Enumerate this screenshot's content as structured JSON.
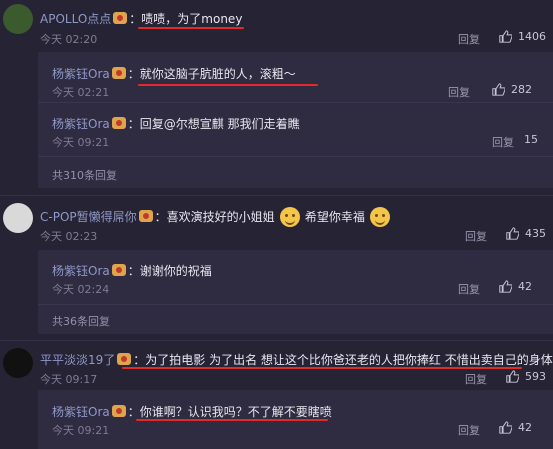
{
  "comments": [
    {
      "user": "APOLLO点点",
      "text": "啧啧，为了money",
      "time": "今天 02:20",
      "reply_label": "回复",
      "likes": "1406",
      "sub": [
        {
          "user": "杨紫钰Ora",
          "text": "就你这脑子肮脏的人，滚粗～",
          "time": "今天 02:21",
          "reply_label": "回复",
          "likes": "282"
        },
        {
          "user": "杨紫钰Ora",
          "text": "回复@尔想宣麒 那我们走着瞧",
          "time": "今天 09:21",
          "reply_label": "回复",
          "likes": "15"
        }
      ],
      "more": "共310条回复"
    },
    {
      "user": "C-POP暂懒得屌你",
      "text_a": "喜欢演技好的小姐姐",
      "text_b": "希望你幸福",
      "time": "今天 02:23",
      "reply_label": "回复",
      "likes": "435",
      "sub": [
        {
          "user": "杨紫钰Ora",
          "text": "谢谢你的祝福",
          "time": "今天 02:24",
          "reply_label": "回复",
          "likes": "42"
        }
      ],
      "more": "共36条回复"
    },
    {
      "user": "平平淡淡19了",
      "text": "为了拍电影 为了出名 想让这个比你爸还老的人把你捧红  不惜出卖自己的身体",
      "time": "今天 09:17",
      "reply_label": "回复",
      "likes": "593",
      "sub": [
        {
          "user": "杨紫钰Ora",
          "text": "你谁啊？认识我吗？不了解不要瞎喷",
          "time": "今天 09:21",
          "reply_label": "回复",
          "likes": "42"
        }
      ]
    }
  ],
  "colors": {
    "underline": "#e22a2a",
    "name": "#8f98c9",
    "background": "#262334"
  }
}
